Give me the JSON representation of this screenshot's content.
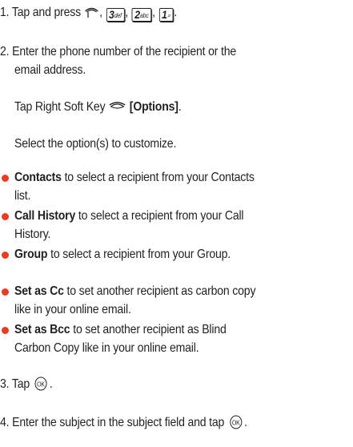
{
  "steps": {
    "step1": {
      "prefix": "1. Tap and press",
      "keys": [
        {
          "num": "3",
          "sub": "def"
        },
        {
          "num": "2",
          "sub": "abc"
        },
        {
          "num": "1",
          "sub": "ﾠ"
        }
      ],
      "icons": [
        "left-soft-key-icon",
        "key-3-def-icon",
        "key-2-abc-icon",
        "key-1-voicemail-icon"
      ]
    },
    "step2": {
      "line1": "2. Enter the phone number of the recipient or the",
      "line2": "email address.",
      "tap_prefix": "Tap Right Soft Key",
      "tap_bold": "[Options]",
      "tap_suffix": ".",
      "select": "Select the option(s) to customize."
    },
    "options": [
      {
        "bold": "Contacts",
        "rest": " to select a recipient from your Contacts",
        "cont": "list."
      },
      {
        "bold": "Call History",
        "rest": " to select a recipient from your Call",
        "cont": "History."
      },
      {
        "bold": "Group",
        "rest": " to select a recipient from your Group.",
        "cont": ""
      },
      {
        "bold": "Set as Cc",
        "rest": " to set another recipient as carbon copy",
        "cont": "like in your online email."
      },
      {
        "bold": "Set as Bcc",
        "rest": " to set another recipient as Blind",
        "cont": "Carbon Copy like in your online email."
      }
    ],
    "step3": {
      "text": "3. Tap",
      "suffix": ".",
      "icon": "ok-key-icon"
    },
    "step4": {
      "text": "4. Enter the subject in the subject field and tap",
      "suffix": ".",
      "icon": "ok-key-icon"
    }
  },
  "colors": {
    "bullet": "#ea3b1f",
    "text": "#231f20"
  }
}
